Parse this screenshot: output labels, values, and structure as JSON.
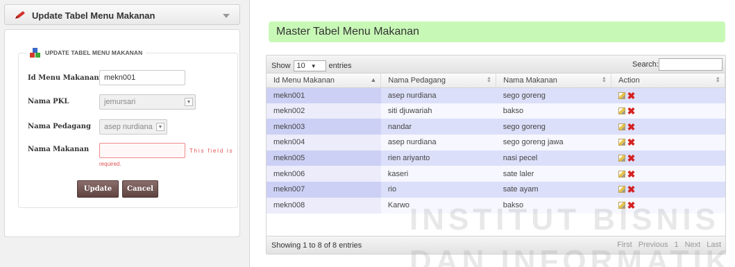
{
  "left_panel": {
    "header_title": "Update Tabel Menu Makanan",
    "legend": "UPDATE TABEL MENU MAKANAN",
    "fields": [
      {
        "label": "Id Menu Makanan",
        "value": "mekn001"
      },
      {
        "label": "Nama PKL",
        "value": "jemursari"
      },
      {
        "label": "Nama Pedagang",
        "value": "asep nurdiana"
      },
      {
        "label": "Nama Makanan",
        "value": ""
      }
    ],
    "error_text_side": "This field is",
    "error_text_bottom": "required.",
    "update_label": "Update",
    "cancel_label": "Cancel"
  },
  "master": {
    "title": "Master Tabel Menu Makanan",
    "show_label": "Show",
    "length_value": "10",
    "entries_label": "entries",
    "search_label": "Search:",
    "columns": [
      "Id Menu Makanan",
      "Nama Pedagang",
      "Nama Makanan",
      "Action"
    ],
    "rows": [
      [
        "mekn001",
        "asep nurdiana",
        "sego goreng"
      ],
      [
        "mekn002",
        "siti djuwariah",
        "bakso"
      ],
      [
        "mekn003",
        "nandar",
        "sego goreng"
      ],
      [
        "mekn004",
        "asep nurdiana",
        "sego goreng jawa"
      ],
      [
        "mekn005",
        "rien ariyanto",
        "nasi pecel"
      ],
      [
        "mekn006",
        "kaseri",
        "sate laler"
      ],
      [
        "mekn007",
        "rio",
        "sate ayam"
      ],
      [
        "mekn008",
        "Karwo",
        "bakso"
      ]
    ],
    "info": "Showing 1 to 8 of 8 entries",
    "pager": [
      "First",
      "Previous",
      "1",
      "Next",
      "Last"
    ]
  },
  "watermark": {
    "line1": "INSTITUT BISNIS",
    "line2": "DAN INFORMATIKA"
  },
  "colors": {
    "title_bg": "#c8f8b6",
    "row_odd": "#dcdff9",
    "row_even": "#f7f7ff",
    "button": "#6e5250",
    "error": "#e05050"
  }
}
